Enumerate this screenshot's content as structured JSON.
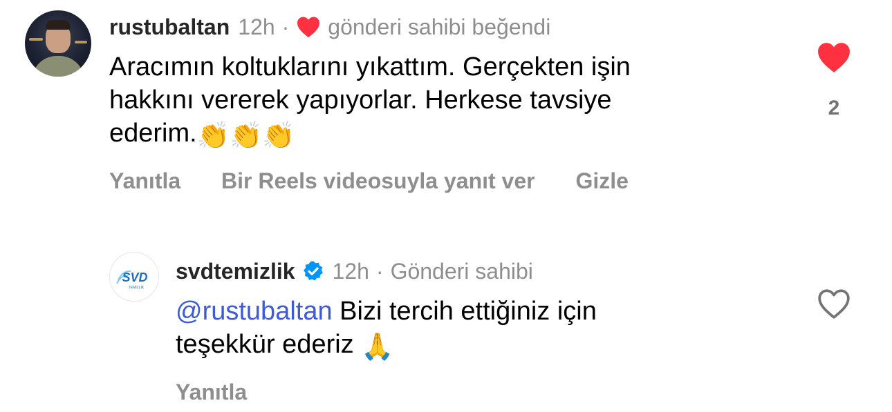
{
  "comments": [
    {
      "username": "rustubaltan",
      "time": "12h",
      "separator": "·",
      "liked_note": "gönderi sahibi beğendi",
      "lines": [
        "Aracımın koltuklarını yıkattım. Gerçekten işin",
        "hakkını vererek yapıyorlar. Herkese tavsiye",
        "ederim."
      ],
      "emojis": "👏👏👏",
      "actions": {
        "reply": "Yanıtla",
        "reels_reply": "Bir Reels videosuyla yanıt ver",
        "hide": "Gizle"
      },
      "like_count": "2",
      "liked": true
    },
    {
      "username": "svdtemizlik",
      "verified": true,
      "time": "12h",
      "separator": "·",
      "author_note": "Gönderi sahibi",
      "mention": "@rustubaltan",
      "lines": [
        "Bizi tercih ettiğiniz için",
        "teşekkür ederiz"
      ],
      "emojis": "🙏",
      "actions": {
        "reply": "Yanıtla"
      },
      "liked": false
    }
  ],
  "logo": {
    "text": "SVD",
    "subtext": "TEMİZLİK"
  },
  "colors": {
    "like_red": "#ff3040",
    "muted": "#8e8e8e",
    "mention": "#3b5bdb",
    "verified_blue": "#0095f6"
  },
  "icons": [
    "heart-filled-icon",
    "heart-outline-icon",
    "verified-badge-icon"
  ]
}
